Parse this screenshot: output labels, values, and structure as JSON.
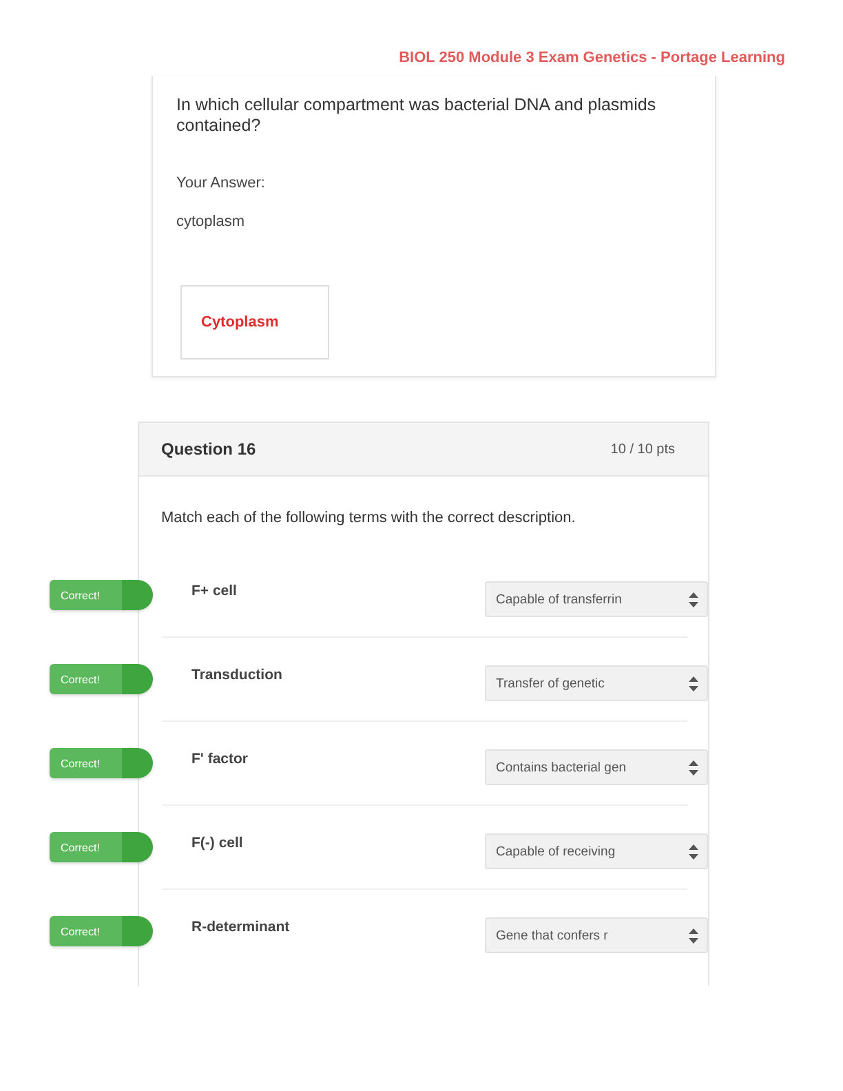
{
  "page_header": {
    "text": "BIOL 250 Module 3 Exam Genetics - Portage Learning"
  },
  "previous_question": {
    "prompt": "In which cellular compartment was bacterial DNA and plasmids contained?",
    "answer_label": "Your Answer:",
    "answer": "cytoplasm",
    "comment": "Cytoplasm"
  },
  "question": {
    "title": "Question 16",
    "points": "10 / 10 pts",
    "prompt": "Match each of the following terms with the correct description.",
    "matches": [
      {
        "result": "Correct!",
        "correct": true,
        "term": "F+ cell",
        "selected_description": "Capable of transferrin"
      },
      {
        "result": "Correct!",
        "correct": true,
        "term": "Transduction",
        "selected_description": "Transfer of genetic"
      },
      {
        "result": "Correct!",
        "correct": true,
        "term": "F' factor",
        "selected_description": "Contains bacterial gen"
      },
      {
        "result": "Correct!",
        "correct": true,
        "term": "F(-) cell",
        "selected_description": "Capable of receiving"
      },
      {
        "result": "Correct!",
        "correct": true,
        "term": "R-determinant",
        "selected_description": "Gene that confers r"
      }
    ]
  }
}
